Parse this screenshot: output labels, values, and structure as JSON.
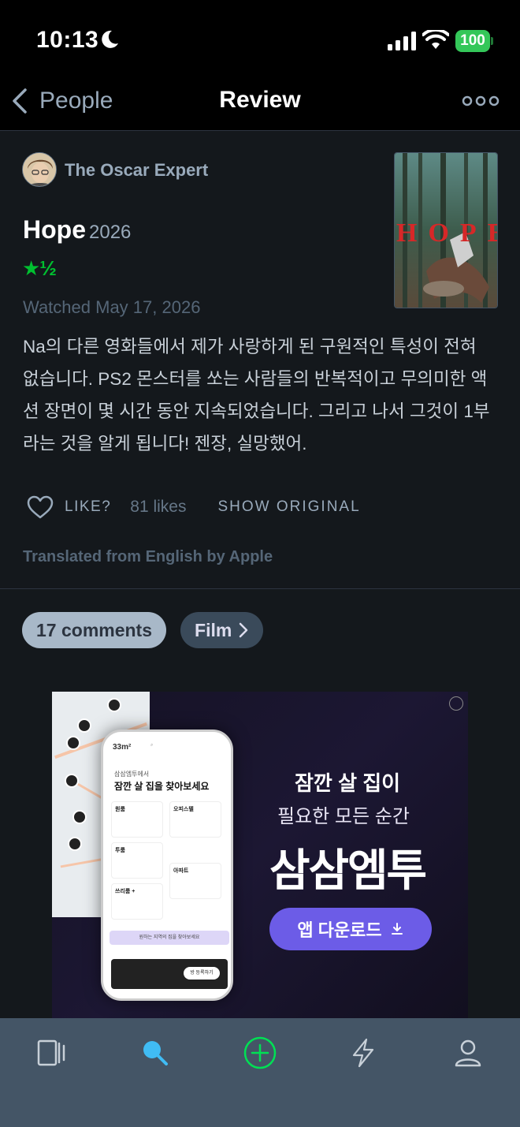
{
  "status_bar": {
    "time": "10:13",
    "battery": "100"
  },
  "nav": {
    "back_label": "People",
    "title": "Review"
  },
  "review": {
    "reviewer": "The Oscar Expert",
    "film_title": "Hope",
    "film_year": "2026",
    "rating_stars": "★½",
    "watched": "Watched May 17, 2026",
    "text": "Na의 다른 영화들에서 제가 사랑하게 된 구원적인 특성이 전혀 없습니다. PS2 몬스터를 쏘는 사람들의 반복적이고 무의미한 액션 장면이 몇 시간 동안 지속되었습니다. 그리고 나서 그것이 1부라는 것을 알게 됩니다! 젠장, 실망했어.",
    "like_label": "LIKE?",
    "likes_count": "81 likes",
    "show_original": "SHOW ORIGINAL",
    "translated_note": "Translated from English by Apple",
    "poster_letters": "HOPE"
  },
  "pills": {
    "comments": "17 comments",
    "film": "Film"
  },
  "ad": {
    "line1": "잠깐 살 집이",
    "line2": "필요한 모든 순간",
    "brand": "삼삼엠투",
    "cta": "앱 다운로드",
    "phone_sub": "삼삼엠투에서",
    "phone_title": "잠깐 살 집을 찾아보세요",
    "cards": [
      "원룸",
      "오피스텔",
      "투룸",
      "아파트",
      "쓰리룸 +"
    ],
    "phone_bar": "원하는 지역의 집을 찾아보세요",
    "phone_btn": "방 등록하기"
  },
  "tabbar": {
    "items": [
      "activity-icon",
      "search-icon",
      "add-icon",
      "lightning-icon",
      "profile-icon"
    ],
    "active": "search-icon",
    "accent_blue": "#40bcf4",
    "accent_green": "#00e054"
  },
  "colors": {
    "background": "#14181c",
    "rating_green": "#00c030"
  }
}
